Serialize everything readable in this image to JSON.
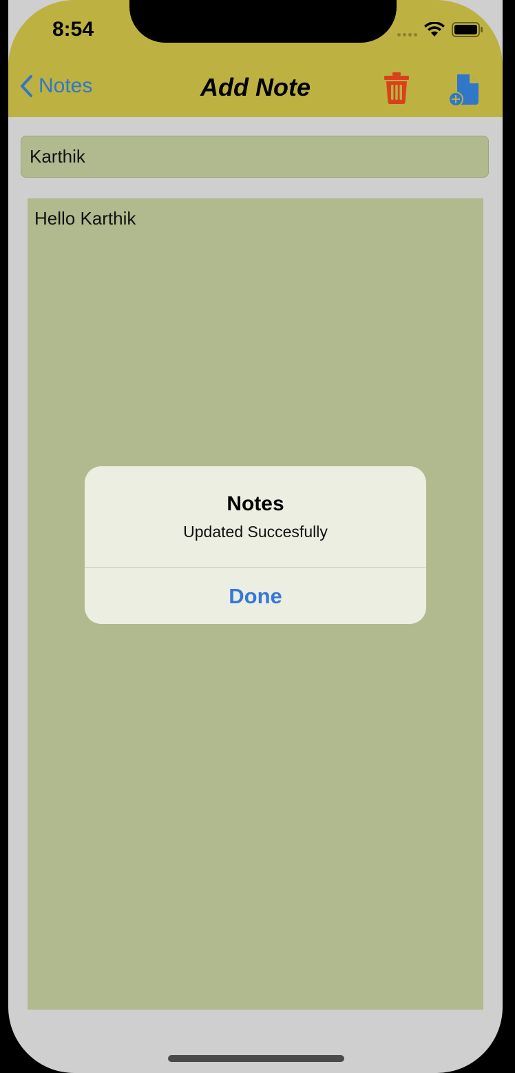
{
  "status_bar": {
    "time": "8:54",
    "icons": [
      "signal-dots-icon",
      "wifi-icon",
      "battery-icon"
    ]
  },
  "nav": {
    "back_label": "Notes",
    "title": "Add Note",
    "actions": [
      "trash-icon",
      "add-file-icon"
    ]
  },
  "note": {
    "title_value": "Karthik",
    "body_value": "Hello Karthik"
  },
  "alert": {
    "title": "Notes",
    "message": "Updated Succesfully",
    "button_label": "Done"
  },
  "colors": {
    "nav_bar": "#bdb141",
    "background": "#cfcfcf",
    "field": "#b1ba8f",
    "tint": "#3077c9",
    "trash": "#d8421a",
    "alert_bg": "#edeee2"
  }
}
